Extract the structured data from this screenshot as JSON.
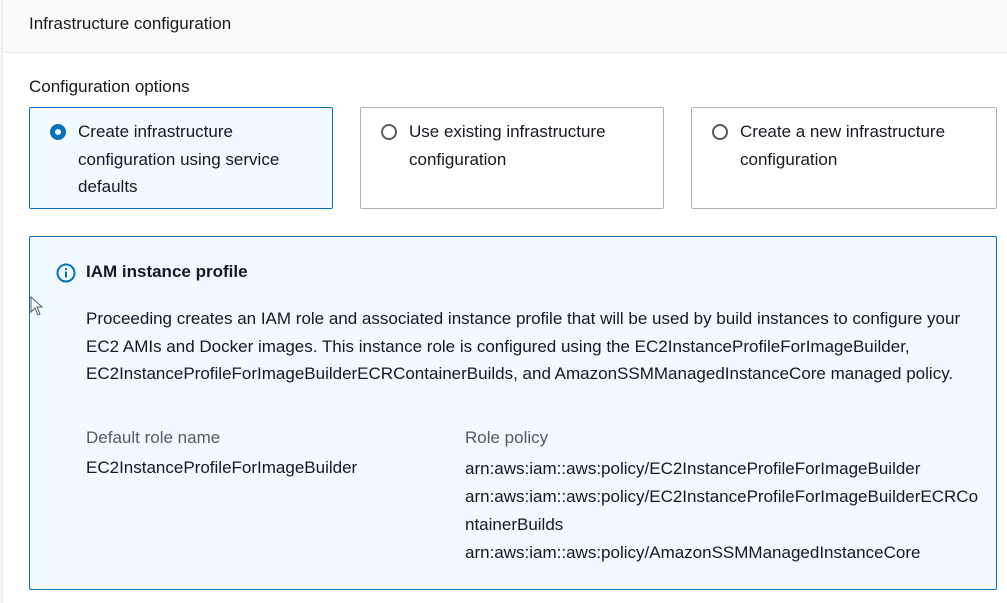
{
  "panel": {
    "title": "Infrastructure configuration"
  },
  "configuration_options": {
    "label": "Configuration options",
    "options": [
      {
        "label": "Create infrastructure configuration using service defaults",
        "selected": true
      },
      {
        "label": "Use existing infrastructure configuration",
        "selected": false
      },
      {
        "label": "Create a new infrastructure configuration",
        "selected": false
      }
    ]
  },
  "info_box": {
    "icon": "info-icon",
    "title": "IAM instance profile",
    "body": "Proceeding creates an IAM role and associated instance profile that will be used by build instances to configure your EC2 AMIs and Docker images. This instance role is configured using the EC2InstanceProfileForImageBuilder, EC2InstanceProfileForImageBuilderECRContainerBuilds, and AmazonSSMManagedInstanceCore managed policy.",
    "default_role_label": "Default role name",
    "default_role_value": "EC2InstanceProfileForImageBuilder",
    "role_policy_label": "Role policy",
    "role_policies": [
      "arn:aws:iam::aws:policy/EC2InstanceProfileForImageBuilder",
      "arn:aws:iam::aws:policy/EC2InstanceProfileForImageBuilderECRContainerBuilds",
      "arn:aws:iam::aws:policy/AmazonSSMManagedInstanceCore"
    ]
  },
  "colors": {
    "accent": "#0073bb",
    "selected_bg": "#f1faff",
    "border": "#aab7b8",
    "text": "#16191f",
    "muted_text": "#545b64"
  }
}
